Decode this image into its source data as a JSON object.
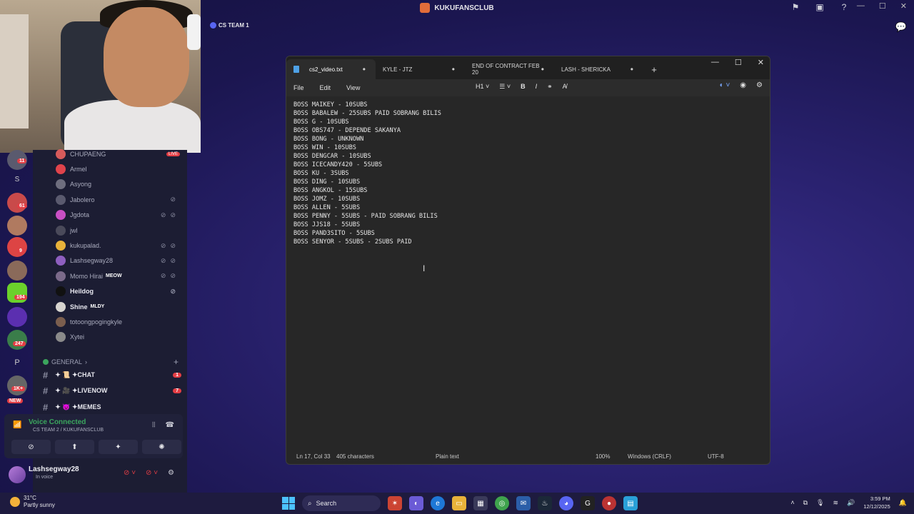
{
  "top": {
    "server_title": "KUKUFANSCLUB",
    "cs_team_label": "CS TEAM 1"
  },
  "rail": {
    "badges": [
      "11",
      "61",
      "9",
      "194",
      "247",
      "1K+",
      "NEW"
    ],
    "letters": [
      "S",
      "P"
    ]
  },
  "members": [
    {
      "name": "CHUPAENG",
      "tag": "LIVE",
      "color": "#e33d44"
    },
    {
      "name": "Armel",
      "tag": "",
      "color": "#e0434b"
    },
    {
      "name": "Asyong",
      "tag": "",
      "color": "#6e6e7e"
    },
    {
      "name": "Jabolero",
      "tag": "",
      "color": "#5a5a6e"
    },
    {
      "name": "Jgdota",
      "tag": "",
      "color": "#c94fc4"
    },
    {
      "name": "jwl",
      "tag": "",
      "color": "#4a4a5a"
    },
    {
      "name": "kukupalad.",
      "tag": "",
      "color": "#e8b23a"
    },
    {
      "name": "Lashsegway28",
      "tag": "",
      "color": "#8e5fbf"
    },
    {
      "name": "Momo Hirai",
      "tag": "MEOW",
      "color": "#7b6a8a"
    },
    {
      "name": "Heildog",
      "tag": "",
      "color": "#1b1b1b"
    },
    {
      "name": "Shine",
      "tag": "MLDY",
      "color": "#d7d4cf"
    },
    {
      "name": "totoongpogingkyle",
      "tag": "",
      "color": "#7b5e4e"
    },
    {
      "name": "Xytei",
      "tag": "",
      "color": "#8a8a8a"
    }
  ],
  "general": {
    "label": "GENERAL",
    "channels": [
      {
        "name": "✦ 📜 ✦CHAT",
        "count": "1"
      },
      {
        "name": "✦ 🎥 ✦LIVENOW",
        "count": "7"
      },
      {
        "name": "✦ 😈 ✦MEMES",
        "count": ""
      }
    ]
  },
  "voice": {
    "status": "Voice Connected",
    "channel": "CS TEAM 2 / KUKUFANSCLUB"
  },
  "user": {
    "name": "Lashsegway28",
    "status": "In voice"
  },
  "notepad": {
    "tabs": [
      {
        "label": "cs2_video.txt",
        "active": true
      },
      {
        "label": "KYLE - JTZ",
        "active": false
      },
      {
        "label": "END OF CONTRACT FEB 20",
        "active": false
      },
      {
        "label": "LASH - SHERICKA",
        "active": false
      }
    ],
    "menu": [
      "File",
      "Edit",
      "View"
    ],
    "heading_label": "H1",
    "lines": [
      "BOSS MAIKEY - 10SUBS",
      "BOSS BABALEW - 25SUBS PAID SOBRANG BILIS",
      "BOSS G - 10SUBS",
      "BOSS OBS747 - DEPENDE SAKANYA",
      "BOSS BONG - UNKNOWN",
      "BOSS WIN - 10SUBS",
      "BOSS DENGCAR - 10SUBS",
      "BOSS ICECANDY420 - 5SUBS",
      "BOSS KU - 3SUBS",
      "BOSS DING - 10SUBS",
      "BOSS ANGKOL - 15SUBS",
      "BOSS JOMZ - 10SUBS",
      "BOSS ALLEN - 5SUBS",
      "BOSS PENNY - 5SUBS - PAID SOBRANG BILIS",
      "BOSS JJS18 - 5SUBS",
      "BOSS PAND3SITO - 5SUBS",
      "BOSS SENYOR - 5SUBS - 2SUBS PAID"
    ],
    "status": {
      "position": "Ln 17, Col 33",
      "chars": "405 characters",
      "format": "Plain text",
      "zoom": "100%",
      "eol": "Windows (CRLF)",
      "encoding": "UTF-8"
    }
  },
  "taskbar": {
    "temp": "31°C",
    "weather": "Partly sunny",
    "search": "Search",
    "time": "3:59 PM",
    "date": "12/12/2025"
  }
}
